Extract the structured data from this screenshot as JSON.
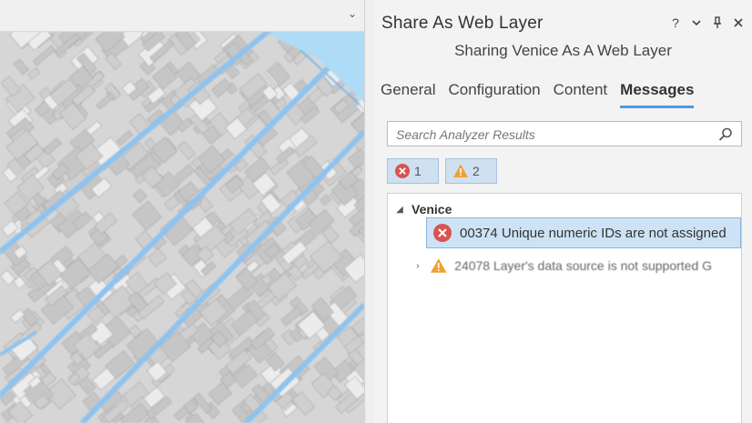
{
  "pane": {
    "title": "Share As Web Layer",
    "subtitle": "Sharing Venice As A Web Layer",
    "controls": {
      "help": "?",
      "options": "⌄",
      "pin": "📌",
      "close": "✕"
    },
    "tabs": [
      {
        "label": "General",
        "active": false
      },
      {
        "label": "Configuration",
        "active": false
      },
      {
        "label": "Content",
        "active": false
      },
      {
        "label": "Messages",
        "active": true
      }
    ],
    "search": {
      "placeholder": "Search Analyzer Results",
      "icon": "search-icon"
    },
    "filters": {
      "errors": {
        "count": "1",
        "icon": "error-icon"
      },
      "warnings": {
        "count": "2",
        "icon": "warning-icon"
      }
    },
    "results": {
      "group": "Venice",
      "messages": [
        {
          "severity": "error",
          "text": "00374 Unique numeric IDs are not assigned",
          "selected": true
        },
        {
          "severity": "warning",
          "text": "24078 Layer's data source is not supported G",
          "selected": false
        }
      ]
    }
  },
  "colors": {
    "accent": "#4d9be6",
    "error": "#d9534f",
    "warning": "#f0a030",
    "selection": "#cde3f5",
    "water": "#aedcf7",
    "road": "#8fc3ee"
  }
}
